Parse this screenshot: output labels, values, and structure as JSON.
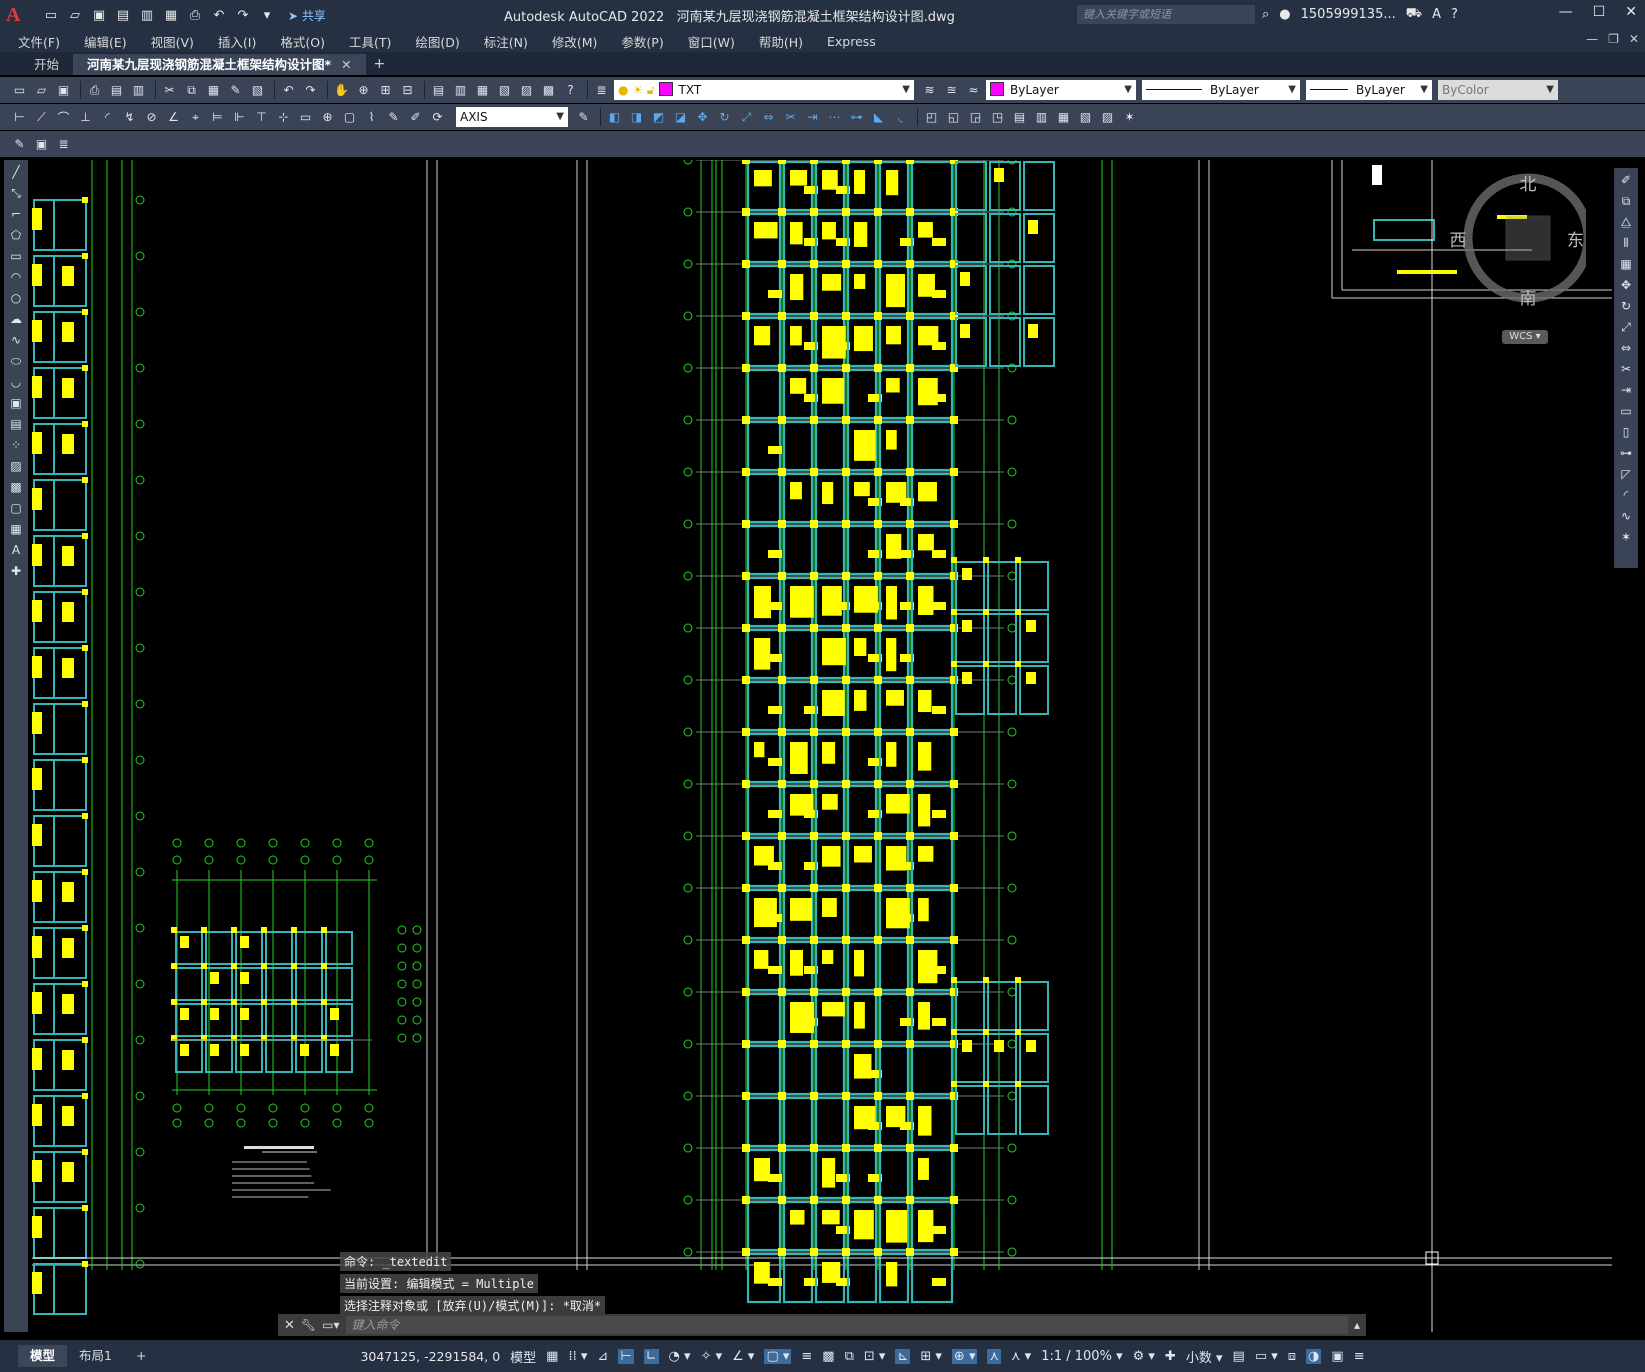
{
  "title_bar": {
    "app_name": "Autodesk AutoCAD 2022",
    "file_name": "河南某九层现浇钢筋混凝土框架结构设计图.dwg",
    "share_label": "共享",
    "search_placeholder": "键入关键字或短语",
    "user_name": "1505999135...",
    "icons": [
      "autocad-logo",
      "new-icon",
      "open-icon",
      "save-icon",
      "saveas-icon",
      "publish-icon",
      "print-icon",
      "undo-icon",
      "redo-icon",
      "share-icon",
      "search-icon",
      "user-icon",
      "cart-icon",
      "help-icon"
    ]
  },
  "window_controls": {
    "minimize": "—",
    "maximize": "☐",
    "close": "✕"
  },
  "menu": {
    "items": [
      "文件(F)",
      "编辑(E)",
      "视图(V)",
      "插入(I)",
      "格式(O)",
      "工具(T)",
      "绘图(D)",
      "标注(N)",
      "修改(M)",
      "参数(P)",
      "窗口(W)",
      "帮助(H)",
      "Express"
    ]
  },
  "tabs": {
    "start_label": "开始",
    "active_label": "河南某九层现浇钢筋混凝土框架结构设计图*",
    "close": "✕",
    "add": "+"
  },
  "toolbar": {
    "layer_name": "TXT",
    "color": "ByLayer",
    "linetype": "ByLayer",
    "lineweight": "ByLayer",
    "plotstyle": "ByColor",
    "dimstyle": "AXIS"
  },
  "viewcube": {
    "north": "北",
    "south": "南",
    "east": "东",
    "west": "西",
    "wcs": "WCS"
  },
  "command": {
    "history": [
      "命令: _textedit",
      "当前设置: 编辑模式 = Multiple",
      "选择注释对象或 [放弃(U)/模式(M)]: *取消*"
    ],
    "placeholder": "键入命令"
  },
  "status": {
    "model_tab": "模型",
    "layout_tab": "布局1",
    "add": "+",
    "coordinates": "3047125, -2291584, 0",
    "space": "模型",
    "scale": "1:1 / 100%",
    "units": "小数"
  },
  "colors": {
    "title_bg": "#253043",
    "toolbar_bg": "#3b4456",
    "canvas_bg": "#000000",
    "axis_green": "#22d022",
    "beam_cyan": "#34b6b6",
    "column_yellow": "#ffff00",
    "layer_magenta": "#ff00ff"
  }
}
